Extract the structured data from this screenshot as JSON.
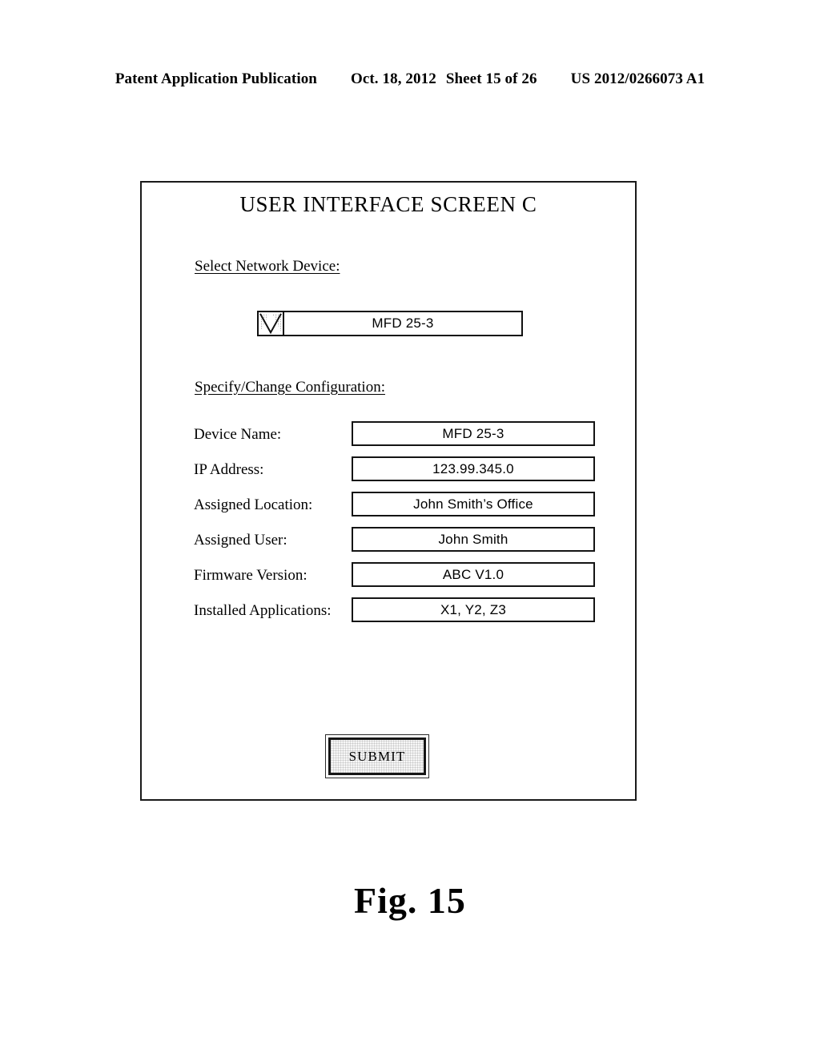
{
  "page_header": {
    "publication": "Patent Application Publication",
    "date": "Oct. 18, 2012",
    "sheet": "Sheet 15 of 26",
    "patent_number": "US 2012/0266073 A1"
  },
  "screen": {
    "title": "USER INTERFACE SCREEN C",
    "select_device_label": "Select Network Device:",
    "device_dropdown": {
      "selected": "MFD 25-3",
      "arrow_icon": "chevron-down-icon"
    },
    "config_label": "Specify/Change Configuration:",
    "fields": [
      {
        "label": "Device Name:",
        "value": "MFD 25-3"
      },
      {
        "label": "IP Address:",
        "value": "123.99.345.0"
      },
      {
        "label": "Assigned Location:",
        "value": "John Smith’s Office"
      },
      {
        "label": "Assigned User:",
        "value": "John Smith"
      },
      {
        "label": "Firmware Version:",
        "value": "ABC V1.0"
      },
      {
        "label": "Installed Applications:",
        "value": "X1, Y2, Z3"
      }
    ],
    "submit_label": "SUBMIT"
  },
  "figure_caption": "Fig. 15",
  "colors": {
    "ink": "#000000",
    "frame": "#1a1a1a",
    "paper": "#ffffff",
    "button_fill": "#f7f7f7",
    "arrow_shade": "#d9d9d9"
  }
}
